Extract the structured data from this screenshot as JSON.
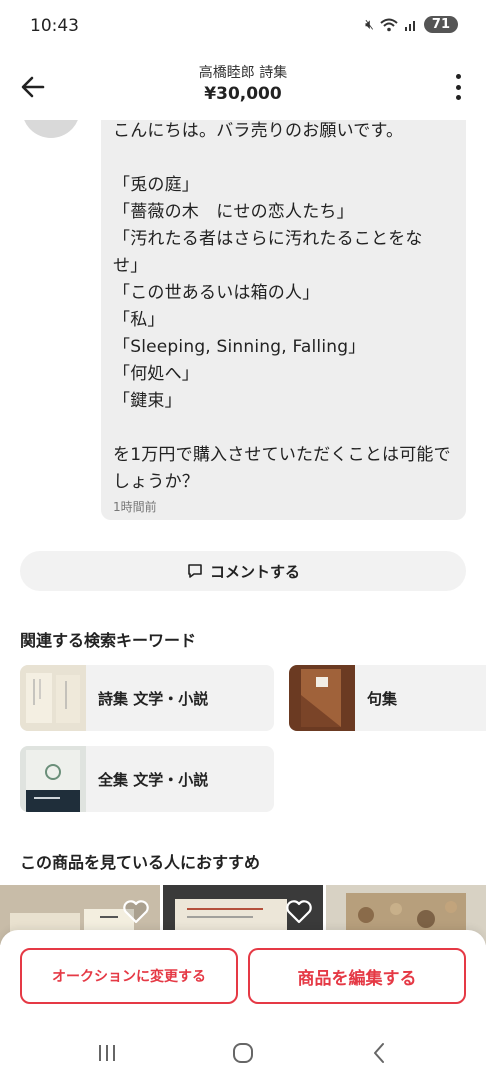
{
  "status_bar": {
    "time": "10:43",
    "battery": "71",
    "icons": [
      "mute-icon",
      "wifi-icon",
      "signal-icon"
    ]
  },
  "header": {
    "title": "高橋睦郎 詩集",
    "price": "¥30,000"
  },
  "comment": {
    "text": "こんにちは。バラ売りのお願いです。\n\n「兎の庭」\n「薔薇の木　にせの恋人たち」\n「汚れたる者はさらに汚れたることをなせ」\n「この世あるいは箱の人」\n「私」\n「Sleeping, Sinning, Falling」\n「何処へ」\n「鍵束」\n\nを1万円で購入させていただくことは可能でしょうか？",
    "time": "1時間前"
  },
  "comment_button": {
    "label": "コメントする"
  },
  "related_keywords": {
    "title": "関連する検索キーワード",
    "items": [
      {
        "label": "詩集 文学・小説"
      },
      {
        "label": "句集"
      },
      {
        "label": "全集 文学・小説"
      }
    ]
  },
  "recommendations": {
    "title": "この商品を見ている人におすすめ"
  },
  "actions": {
    "change_to_auction": "オークションに変更する",
    "edit_item": "商品を編集する"
  },
  "colors": {
    "accent": "#e53945",
    "bubble": "#eeeeee",
    "card": "#f2f2f2"
  }
}
